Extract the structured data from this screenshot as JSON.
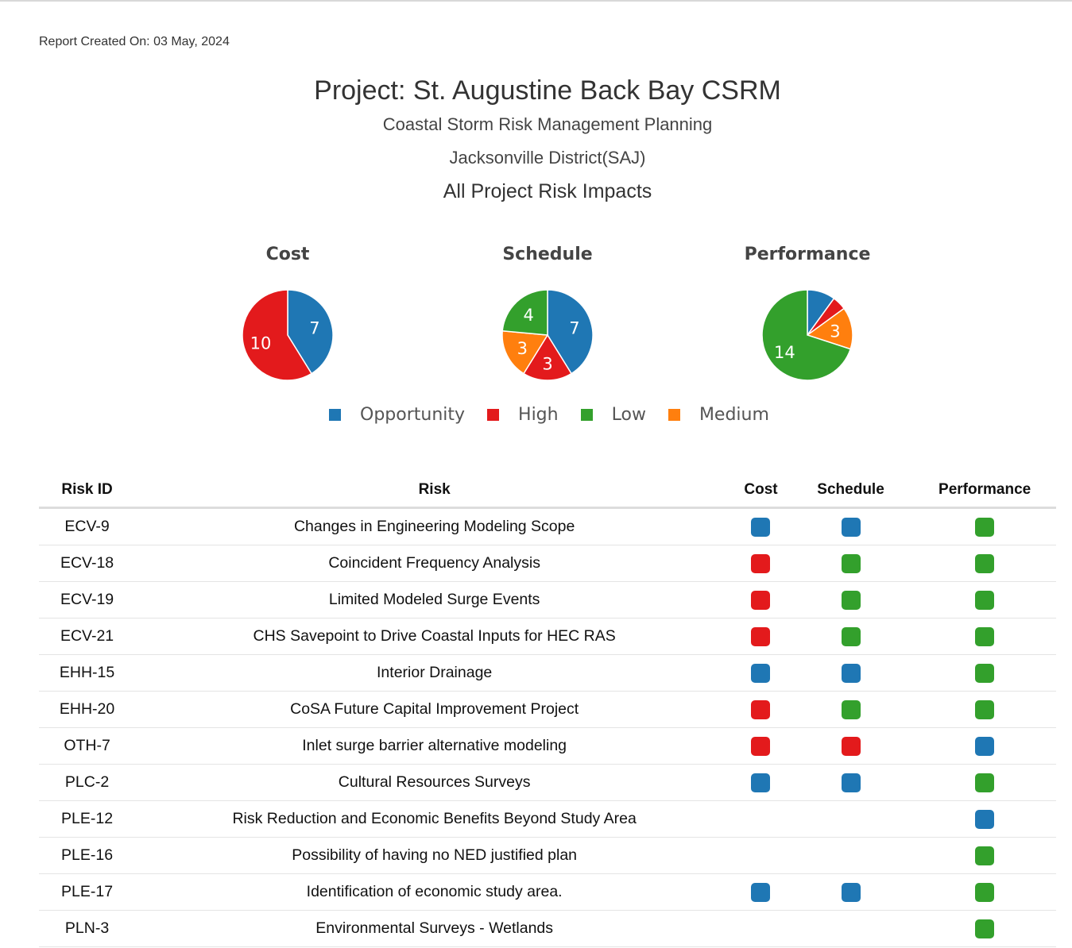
{
  "report": {
    "created_label": "Report Created On: 03 May, 2024"
  },
  "project": {
    "title": "Project: St. Augustine Back Bay CSRM",
    "program": "Coastal Storm Risk Management Planning",
    "district": "Jacksonville District(SAJ)",
    "section_title": "All Project Risk Impacts"
  },
  "colors": {
    "Opportunity": "#1f77b4",
    "High": "#e31a1c",
    "Low": "#33a02c",
    "Medium": "#ff7f0e"
  },
  "chart_data": [
    {
      "type": "pie",
      "title": "Cost",
      "slices": [
        {
          "category": "Opportunity",
          "value": 7,
          "label": "7"
        },
        {
          "category": "High",
          "value": 10,
          "label": "10"
        }
      ]
    },
    {
      "type": "pie",
      "title": "Schedule",
      "slices": [
        {
          "category": "Opportunity",
          "value": 7,
          "label": "7"
        },
        {
          "category": "High",
          "value": 3,
          "label": "3"
        },
        {
          "category": "Medium",
          "value": 3,
          "label": "3"
        },
        {
          "category": "Low",
          "value": 4,
          "label": "4"
        }
      ]
    },
    {
      "type": "pie",
      "title": "Performance",
      "slices": [
        {
          "category": "Opportunity",
          "value": 2,
          "label": ""
        },
        {
          "category": "High",
          "value": 1,
          "label": ""
        },
        {
          "category": "Medium",
          "value": 3,
          "label": "3"
        },
        {
          "category": "Low",
          "value": 14,
          "label": "14"
        }
      ]
    }
  ],
  "legend": [
    {
      "label": "Opportunity",
      "color": "#1f77b4"
    },
    {
      "label": "High",
      "color": "#e31a1c"
    },
    {
      "label": "Low",
      "color": "#33a02c"
    },
    {
      "label": "Medium",
      "color": "#ff7f0e"
    }
  ],
  "table": {
    "headers": [
      "Risk ID",
      "Risk",
      "Cost",
      "Schedule",
      "Performance"
    ],
    "rows": [
      {
        "id": "ECV-9",
        "risk": "Changes in Engineering Modeling Scope",
        "cost": "Opportunity",
        "schedule": "Opportunity",
        "performance": "Low"
      },
      {
        "id": "ECV-18",
        "risk": "Coincident Frequency Analysis",
        "cost": "High",
        "schedule": "Low",
        "performance": "Low"
      },
      {
        "id": "ECV-19",
        "risk": "Limited Modeled Surge Events",
        "cost": "High",
        "schedule": "Low",
        "performance": "Low"
      },
      {
        "id": "ECV-21",
        "risk": "CHS Savepoint to Drive Coastal Inputs for HEC RAS",
        "cost": "High",
        "schedule": "Low",
        "performance": "Low"
      },
      {
        "id": "EHH-15",
        "risk": "Interior Drainage",
        "cost": "Opportunity",
        "schedule": "Opportunity",
        "performance": "Low"
      },
      {
        "id": "EHH-20",
        "risk": "CoSA Future Capital Improvement Project",
        "cost": "High",
        "schedule": "Low",
        "performance": "Low"
      },
      {
        "id": "OTH-7",
        "risk": "Inlet surge barrier alternative modeling",
        "cost": "High",
        "schedule": "High",
        "performance": "Opportunity"
      },
      {
        "id": "PLC-2",
        "risk": "Cultural Resources Surveys",
        "cost": "Opportunity",
        "schedule": "Opportunity",
        "performance": "Low"
      },
      {
        "id": "PLE-12",
        "risk": "Risk Reduction and Economic Benefits Beyond Study Area",
        "cost": "",
        "schedule": "",
        "performance": "Opportunity"
      },
      {
        "id": "PLE-16",
        "risk": "Possibility of having no NED justified plan",
        "cost": "",
        "schedule": "",
        "performance": "Low"
      },
      {
        "id": "PLE-17",
        "risk": "Identification of economic study area.",
        "cost": "Opportunity",
        "schedule": "Opportunity",
        "performance": "Low"
      },
      {
        "id": "PLN-3",
        "risk": "Environmental Surveys - Wetlands",
        "cost": "",
        "schedule": "",
        "performance": "Low"
      }
    ]
  }
}
